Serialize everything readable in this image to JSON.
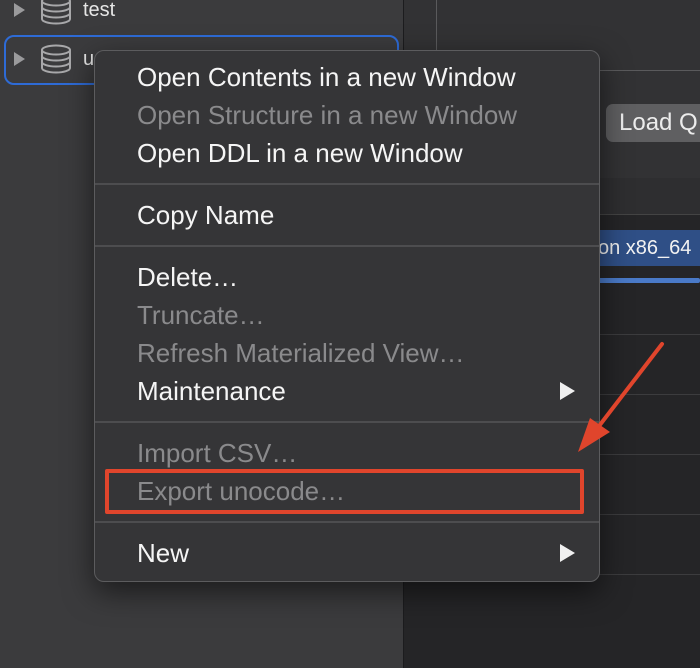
{
  "sidebar": {
    "items": [
      {
        "label": "test",
        "icon": "database-icon"
      },
      {
        "label": "u",
        "icon": "database-icon"
      }
    ]
  },
  "toolbar": {
    "load_button_label": "Load Q"
  },
  "grid": {
    "selected_cell_text": "on x86_64"
  },
  "context_menu": {
    "sections": [
      [
        {
          "label": "Open Contents in a new Window",
          "enabled": true
        },
        {
          "label": "Open Structure in a new Window",
          "enabled": false
        },
        {
          "label": "Open DDL in a new Window",
          "enabled": true
        }
      ],
      [
        {
          "label": "Copy Name",
          "enabled": true
        }
      ],
      [
        {
          "label": "Delete…",
          "enabled": true
        },
        {
          "label": "Truncate…",
          "enabled": false
        },
        {
          "label": "Refresh Materialized View…",
          "enabled": false
        },
        {
          "label": "Maintenance",
          "enabled": true,
          "submenu": true
        }
      ],
      [
        {
          "label": "Import CSV…",
          "enabled": false
        },
        {
          "label": "Export unocode…",
          "enabled": false
        }
      ],
      [
        {
          "label": "New",
          "enabled": true,
          "submenu": true
        }
      ]
    ]
  },
  "annotation": {
    "highlight_color": "#e0452c",
    "highlighted_item": "Export unocode…"
  }
}
